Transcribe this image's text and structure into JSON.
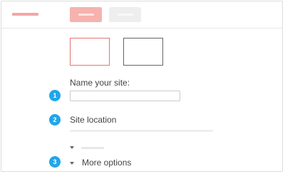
{
  "site_form": {
    "steps": [
      {
        "number": "1",
        "label": "Name your site:"
      },
      {
        "number": "2",
        "label": "Site location"
      },
      {
        "number": "3",
        "label": "More options"
      }
    ],
    "name_input": {
      "value": "",
      "placeholder": ""
    }
  },
  "colors": {
    "accent_step": "#20a6ea",
    "selected_border": "#e57373",
    "primary_button": "#f6b2ae",
    "logo": "#f4a6a3"
  }
}
